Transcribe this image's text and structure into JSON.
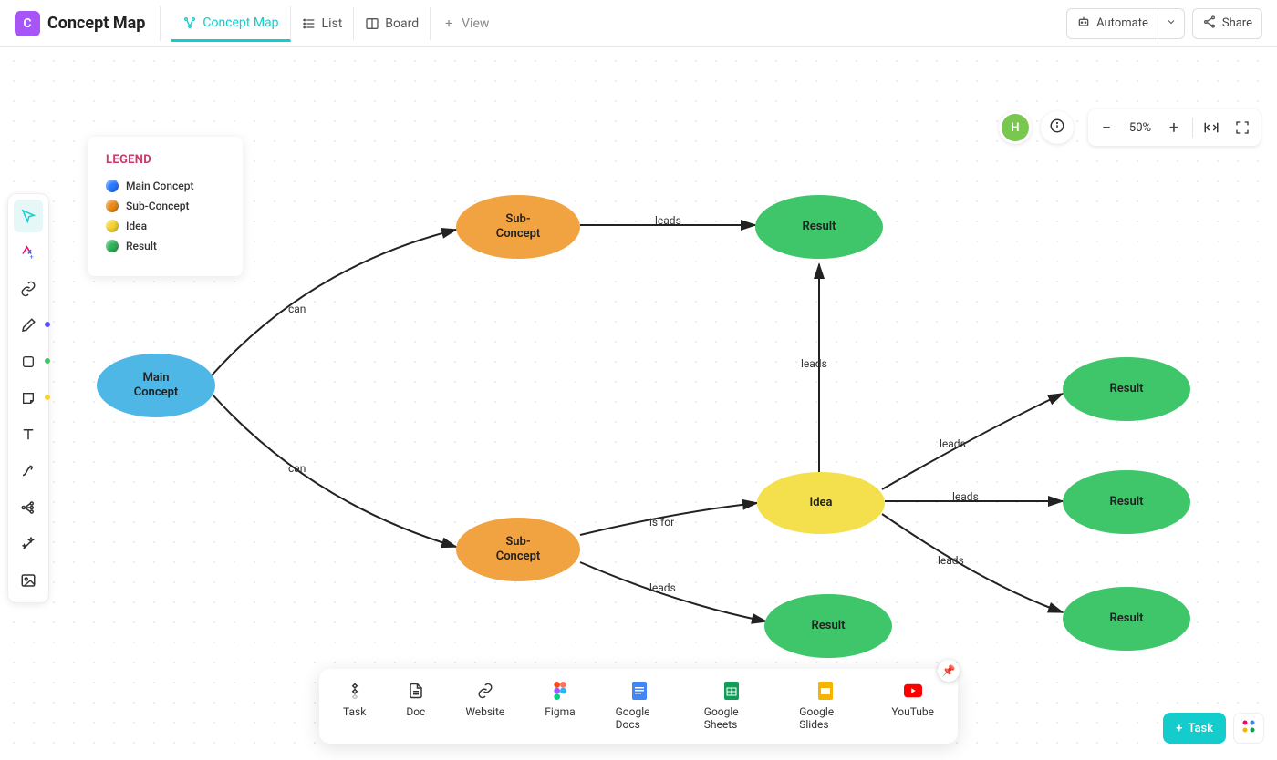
{
  "app": {
    "icon_letter": "C",
    "title": "Concept Map"
  },
  "tabs": {
    "map": "Concept Map",
    "list": "List",
    "board": "Board",
    "add_view": "View"
  },
  "topbar_right": {
    "automate": "Automate",
    "share": "Share"
  },
  "avatar": {
    "letter": "H"
  },
  "zoom": {
    "value": "50%"
  },
  "legend": {
    "title": "LEGEND",
    "items": [
      {
        "label": "Main Concept",
        "color": "#2779ff"
      },
      {
        "label": "Sub-Concept",
        "color": "#e88a1a"
      },
      {
        "label": "Idea",
        "color": "#f4d432"
      },
      {
        "label": "Result",
        "color": "#2fb25a"
      }
    ]
  },
  "nodes": {
    "main": {
      "label": "Main Concept",
      "bg": "#4fb7e6"
    },
    "sub1": {
      "label": "Sub-Concept",
      "bg": "#f2a341"
    },
    "sub2": {
      "label": "Sub-Concept",
      "bg": "#f2a341"
    },
    "idea": {
      "label": "Idea",
      "bg": "#f4e04d"
    },
    "result_t": {
      "label": "Result",
      "bg": "#3fc56a"
    },
    "result_b": {
      "label": "Result",
      "bg": "#3fc56a"
    },
    "result_r1": {
      "label": "Result",
      "bg": "#3fc56a"
    },
    "result_r2": {
      "label": "Result",
      "bg": "#3fc56a"
    },
    "result_r3": {
      "label": "Result",
      "bg": "#3fc56a"
    }
  },
  "edges": {
    "can1": "can",
    "can2": "can",
    "leads1": "leads",
    "is_for": "is for",
    "leads2": "leads",
    "leads3": "leads",
    "leads4": "leads",
    "leads5": "leads",
    "leads6": "leads"
  },
  "dock": {
    "items": [
      {
        "label": "Task"
      },
      {
        "label": "Doc"
      },
      {
        "label": "Website"
      },
      {
        "label": "Figma"
      },
      {
        "label": "Google Docs"
      },
      {
        "label": "Google Sheets"
      },
      {
        "label": "Google Slides"
      },
      {
        "label": "YouTube"
      }
    ]
  },
  "bottom_right": {
    "task": "Task"
  },
  "chart_data": {
    "type": "diagram",
    "title": "Concept Map",
    "node_types": [
      {
        "name": "Main Concept",
        "color": "#2779ff"
      },
      {
        "name": "Sub-Concept",
        "color": "#e88a1a"
      },
      {
        "name": "Idea",
        "color": "#f4d432"
      },
      {
        "name": "Result",
        "color": "#2fb25a"
      }
    ],
    "nodes": [
      {
        "id": "main",
        "label": "Main Concept",
        "type": "Main Concept"
      },
      {
        "id": "sub1",
        "label": "Sub-Concept",
        "type": "Sub-Concept"
      },
      {
        "id": "sub2",
        "label": "Sub-Concept",
        "type": "Sub-Concept"
      },
      {
        "id": "idea",
        "label": "Idea",
        "type": "Idea"
      },
      {
        "id": "result_t",
        "label": "Result",
        "type": "Result"
      },
      {
        "id": "result_b",
        "label": "Result",
        "type": "Result"
      },
      {
        "id": "result_r1",
        "label": "Result",
        "type": "Result"
      },
      {
        "id": "result_r2",
        "label": "Result",
        "type": "Result"
      },
      {
        "id": "result_r3",
        "label": "Result",
        "type": "Result"
      }
    ],
    "edges": [
      {
        "from": "main",
        "to": "sub1",
        "label": "can"
      },
      {
        "from": "main",
        "to": "sub2",
        "label": "can"
      },
      {
        "from": "sub1",
        "to": "result_t",
        "label": "leads"
      },
      {
        "from": "sub2",
        "to": "idea",
        "label": "is for"
      },
      {
        "from": "sub2",
        "to": "result_b",
        "label": "leads"
      },
      {
        "from": "idea",
        "to": "result_t",
        "label": "leads"
      },
      {
        "from": "idea",
        "to": "result_r1",
        "label": "leads"
      },
      {
        "from": "idea",
        "to": "result_r2",
        "label": "leads"
      },
      {
        "from": "idea",
        "to": "result_r3",
        "label": "leads"
      }
    ]
  }
}
